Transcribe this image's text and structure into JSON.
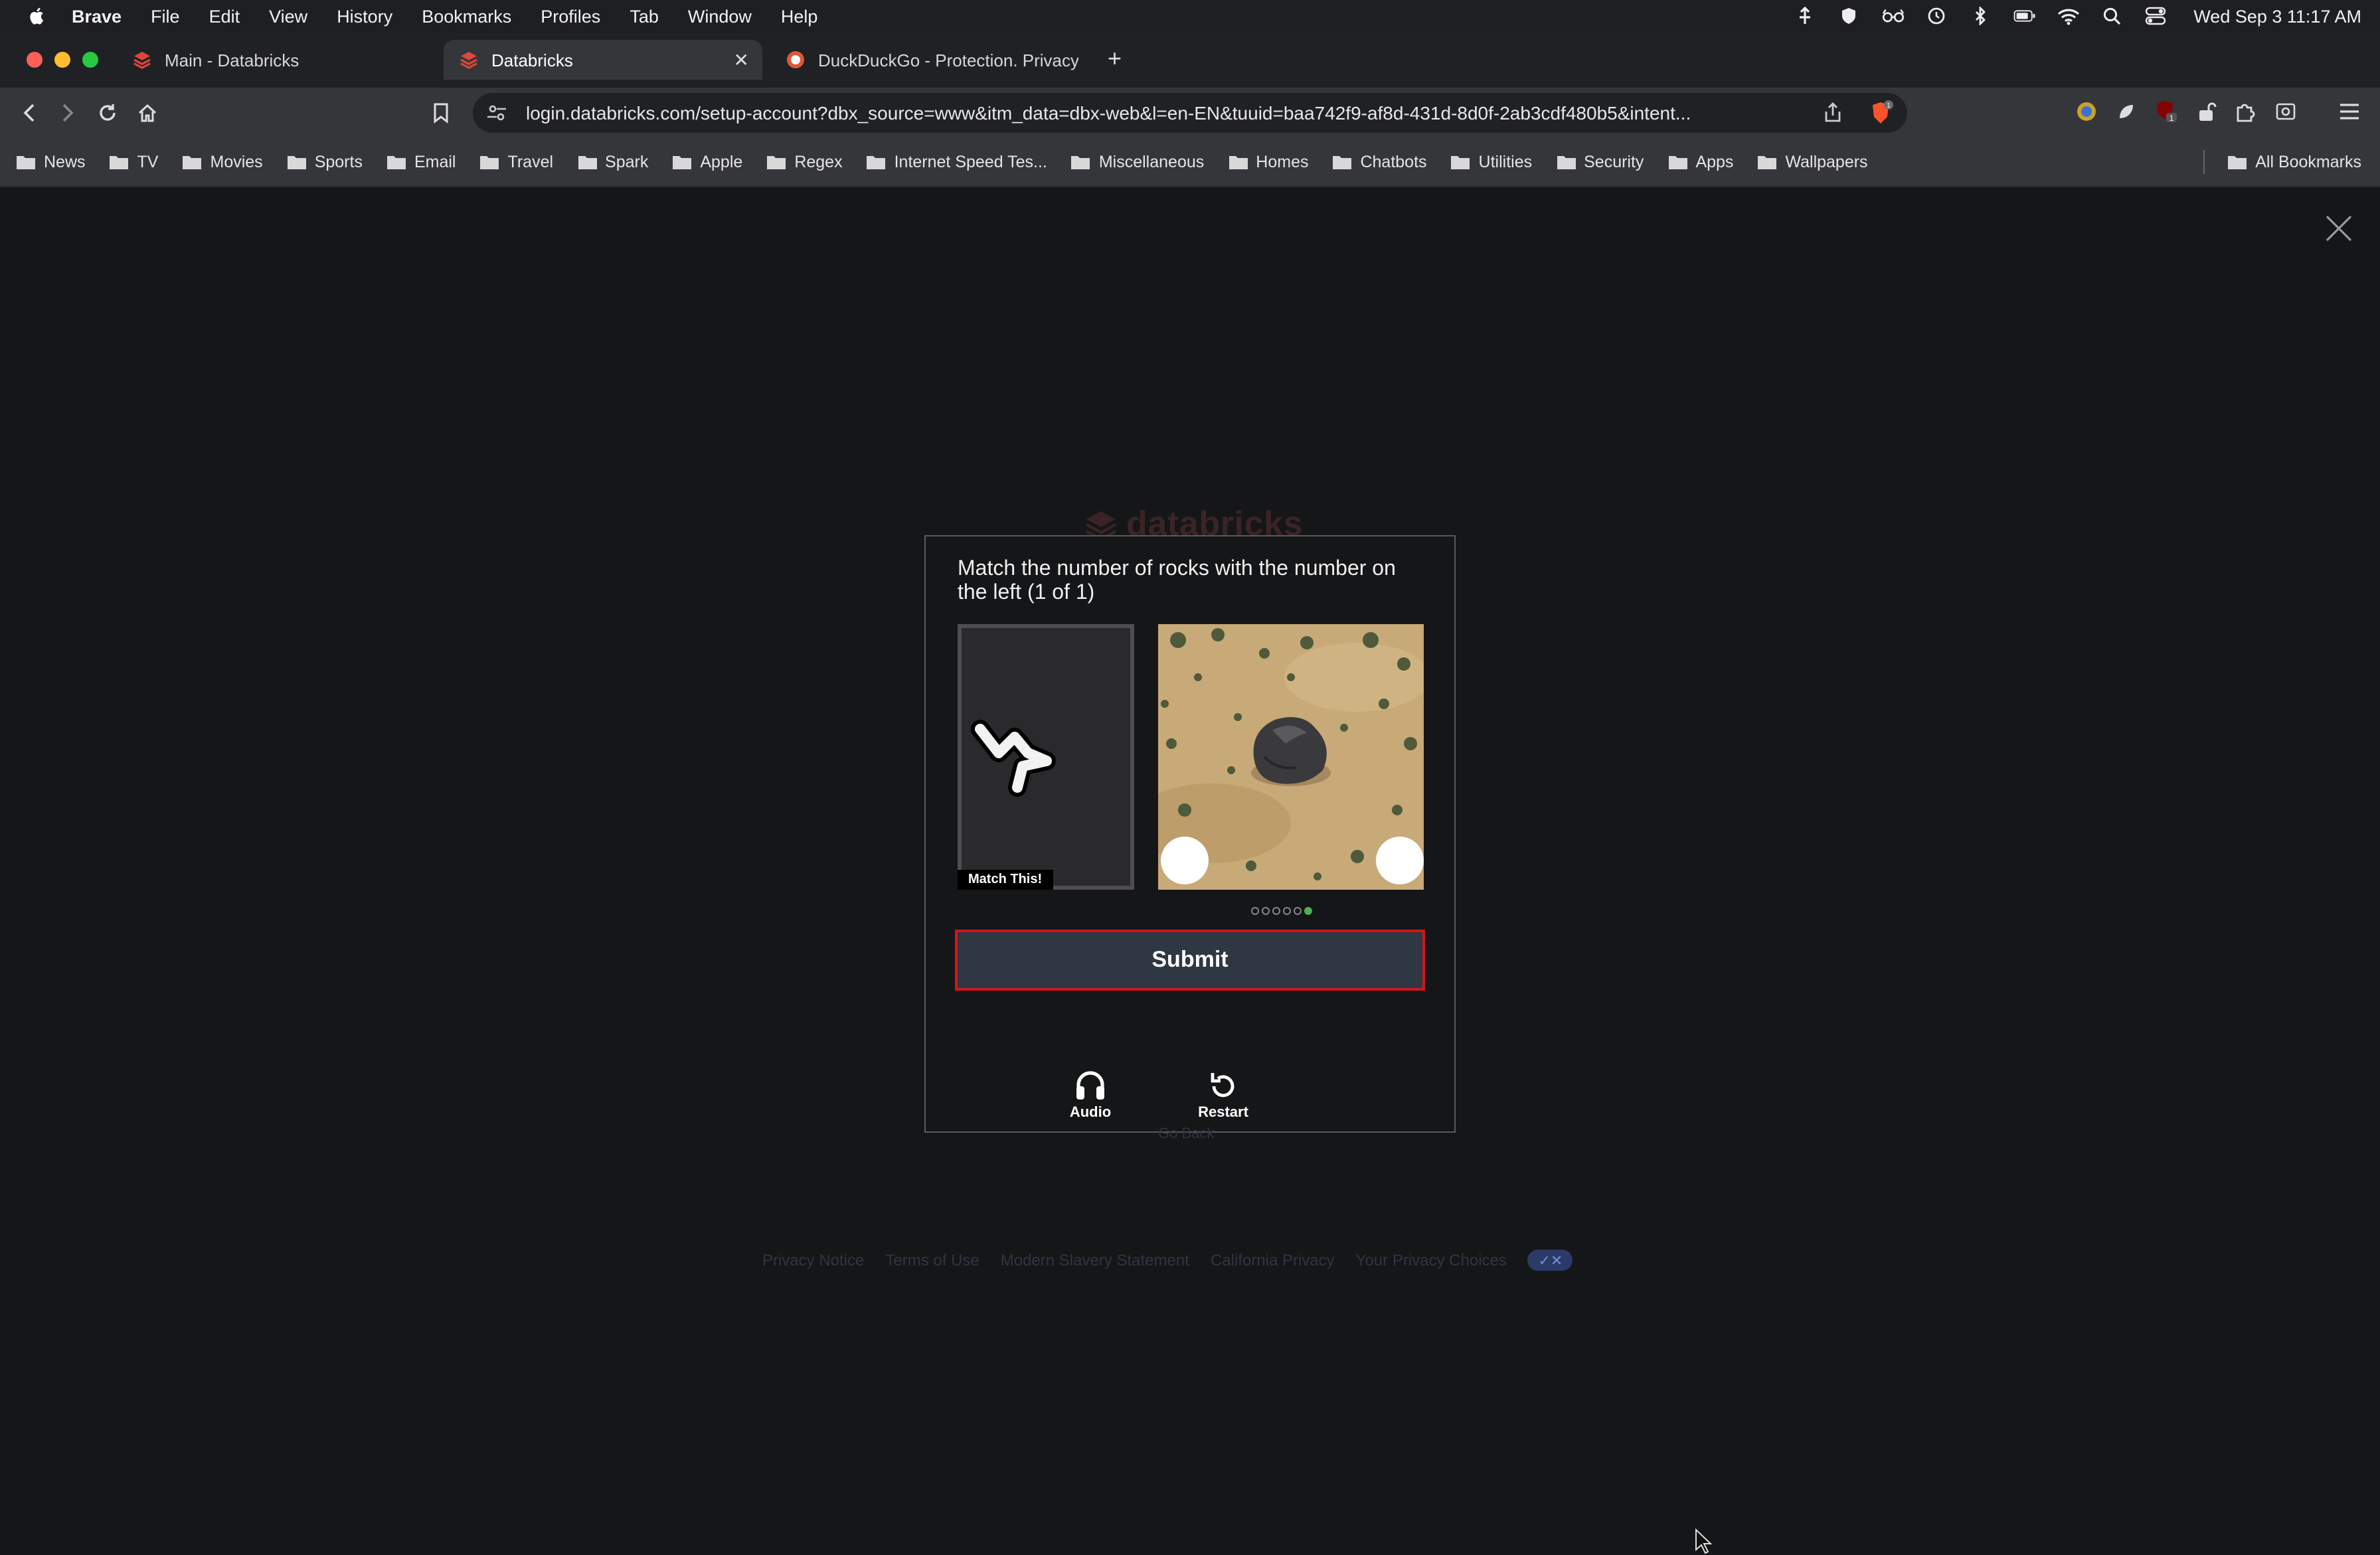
{
  "menubar": {
    "app": "Brave",
    "items": [
      "File",
      "Edit",
      "View",
      "History",
      "Bookmarks",
      "Profiles",
      "Tab",
      "Window",
      "Help"
    ],
    "clock": "Wed Sep 3  11:17 AM"
  },
  "tabs": [
    {
      "title": "Main - Databricks"
    },
    {
      "title": "Databricks"
    },
    {
      "title": "DuckDuckGo - Protection. Privacy"
    }
  ],
  "toolbar": {
    "url": "login.databricks.com/setup-account?dbx_source=www&itm_data=dbx-web&l=en-EN&tuuid=baa742f9-af8d-431d-8d0f-2ab3cdf480b5&intent...",
    "brave_badge": "1",
    "ext_badge": "1"
  },
  "bookmarks": {
    "items": [
      "News",
      "TV",
      "Movies",
      "Sports",
      "Email",
      "Travel",
      "Spark",
      "Apple",
      "Regex",
      "Internet Speed Tes...",
      "Miscellaneous",
      "Homes",
      "Chatbots",
      "Utilities",
      "Security",
      "Apps",
      "Wallpapers"
    ],
    "all": "All Bookmarks"
  },
  "page": {
    "logo_text": "databricks",
    "go_back": "Go Back",
    "footer_links": [
      "Privacy Notice",
      "Terms of Use",
      "Modern Slavery Statement",
      "California Privacy",
      "Your Privacy Choices"
    ]
  },
  "captcha": {
    "prompt": "Match the number of rocks with the number on the left (1 of 1)",
    "match_label": "Match This!",
    "submit_label": "Submit",
    "audio_label": "Audio",
    "restart_label": "Restart",
    "page_dots_total": 6,
    "page_dots_active": 6
  },
  "colors": {
    "submit_border": "#d0161b",
    "submit_bg": "#2f3742",
    "active_dot": "#4caf50"
  }
}
